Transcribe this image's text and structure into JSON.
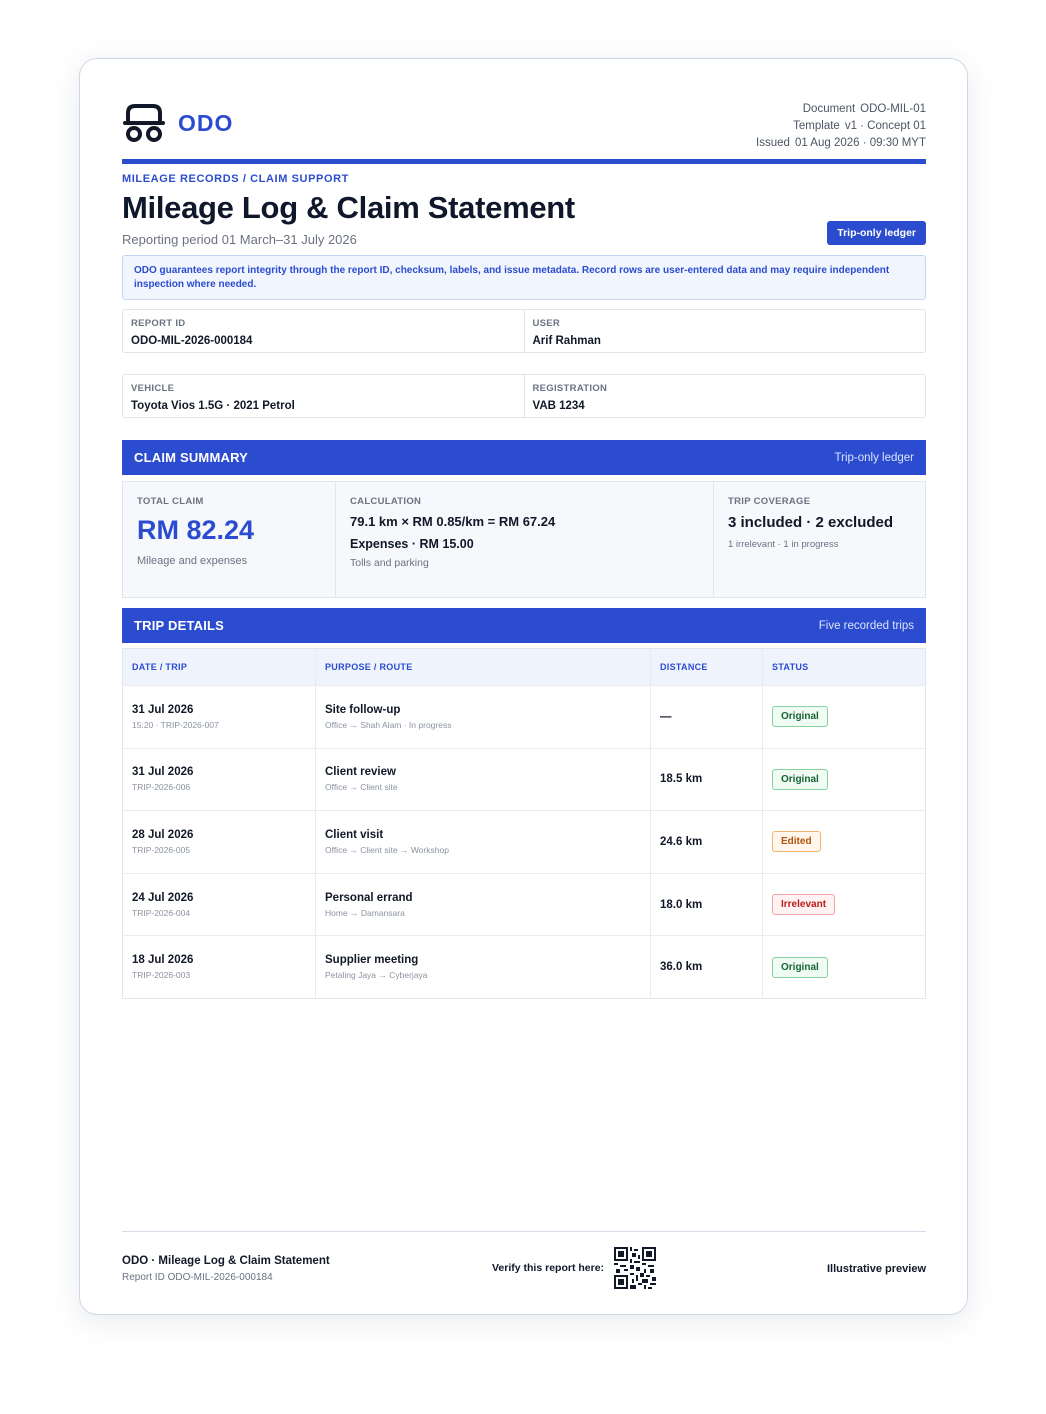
{
  "header": {
    "logo_text": "ODO",
    "document_label": "Document",
    "document_value": "ODO-MIL-01",
    "template_label": "Template",
    "template_value": "v1 · Concept 01",
    "issued_label": "Issued",
    "issued_value": "01 Aug 2026 · 09:30 MYT"
  },
  "title_block": {
    "eyebrow": "MILEAGE RECORDS / CLAIM SUPPORT",
    "title": "Mileage Log & Claim Statement",
    "period": "Reporting period 01 March–31 July 2026",
    "badge": "Trip-only ledger"
  },
  "notice": "ODO guarantees report integrity through the report ID, checksum, labels, and issue metadata. Record rows are user-entered data and may require independent inspection where needed.",
  "info": {
    "report_id_label": "REPORT ID",
    "report_id": "ODO-MIL-2026-000184",
    "user_label": "USER",
    "user": "Arif Rahman",
    "vehicle_label": "VEHICLE",
    "vehicle": "Toyota Vios 1.5G · 2021 Petrol",
    "registration_label": "REGISTRATION",
    "registration": "VAB 1234"
  },
  "claim_summary": {
    "title": "CLAIM SUMMARY",
    "subtitle": "Trip-only ledger",
    "total_label": "TOTAL CLAIM",
    "total_value": "RM 82.24",
    "total_sub": "Mileage and expenses",
    "calc_label": "CALCULATION",
    "calc_line1": "79.1 km × RM 0.85/km = RM 67.24",
    "calc_line2": "Expenses · RM 15.00",
    "calc_line3": "Tolls and parking",
    "coverage_label": "TRIP COVERAGE",
    "coverage_main": "3 included · 2 excluded",
    "coverage_sub": "1 irrelevant · 1 in progress"
  },
  "trip_details": {
    "title": "TRIP DETAILS",
    "subtitle": "Five recorded trips",
    "columns": [
      "DATE / TRIP",
      "PURPOSE / ROUTE",
      "DISTANCE",
      "STATUS"
    ],
    "rows": [
      {
        "date": "31 Jul 2026",
        "trip": "15:20 · TRIP-2026-007",
        "purpose": "Site follow-up",
        "route": "Office → Shah Alam · In progress",
        "distance": "—",
        "status": "Original",
        "status_kind": "original"
      },
      {
        "date": "31 Jul 2026",
        "trip": "TRIP-2026-006",
        "purpose": "Client review",
        "route": "Office → Client site",
        "distance": "18.5 km",
        "status": "Original",
        "status_kind": "original"
      },
      {
        "date": "28 Jul 2026",
        "trip": "TRIP-2026-005",
        "purpose": "Client visit",
        "route": "Office → Client site → Workshop",
        "distance": "24.6 km",
        "status": "Edited",
        "status_kind": "edited"
      },
      {
        "date": "24 Jul 2026",
        "trip": "TRIP-2026-004",
        "purpose": "Personal errand",
        "route": "Home → Damansara",
        "distance": "18.0 km",
        "status": "Irrelevant",
        "status_kind": "irrelevant"
      },
      {
        "date": "18 Jul 2026",
        "trip": "TRIP-2026-003",
        "purpose": "Supplier meeting",
        "route": "Petaling Jaya → Cyberjaya",
        "distance": "36.0 km",
        "status": "Original",
        "status_kind": "original"
      }
    ]
  },
  "footer": {
    "left_title": "ODO · Mileage Log & Claim Statement",
    "left_sub": "Report ID ODO-MIL-2026-000184",
    "verify_label": "Verify this report here:",
    "right": "Illustrative preview"
  },
  "colors": {
    "accent": "#2c4ccf",
    "original": "#166534",
    "edited": "#b45309",
    "irrelevant": "#b91c1c"
  }
}
